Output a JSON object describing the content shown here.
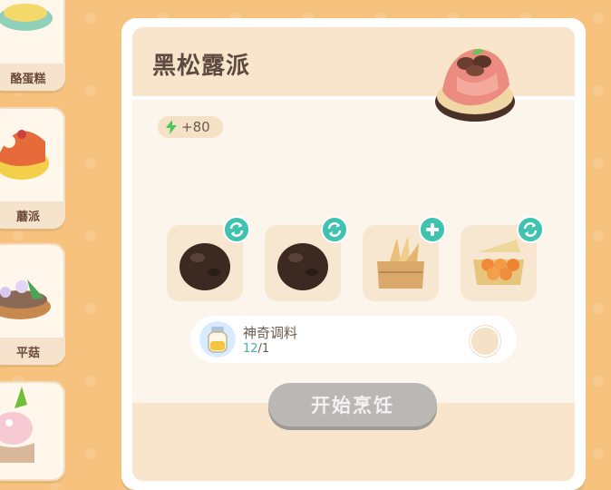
{
  "sidebar": {
    "items": [
      {
        "label": "酪蛋糕"
      },
      {
        "label": "蘑派"
      },
      {
        "label": "平菇"
      },
      {
        "label": ""
      }
    ]
  },
  "recipe": {
    "title": "黑松露派",
    "energy": "+80",
    "ingredients": [
      {
        "name": "truffle",
        "badge": "swap"
      },
      {
        "name": "truffle",
        "badge": "swap"
      },
      {
        "name": "wheat-crate",
        "badge": "add"
      },
      {
        "name": "egg-carton",
        "badge": "swap"
      }
    ],
    "seasoning": {
      "name": "神奇调料",
      "owned": "12",
      "total": "/1"
    },
    "cook_button": "开始烹饪"
  },
  "colors": {
    "accent": "#3fc3b0",
    "button_disabled": "#b9b8b5",
    "background": "#f6c27e"
  }
}
